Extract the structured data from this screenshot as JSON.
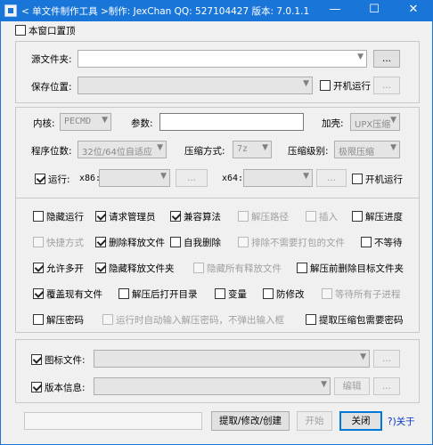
{
  "window": {
    "title": "< 单文件制作工具 >制作: JexChan  QQ: 527104427  版本: 7.0.1.1",
    "minimize": "—",
    "maximize": "☐",
    "close": "✕"
  },
  "top": {
    "on_top": "本窗口置顶"
  },
  "source": {
    "source_label": "源文件夹:",
    "browse": "...",
    "save_label": "保存位置:",
    "startup": "开机运行",
    "browse2": "..."
  },
  "kernel": {
    "core_label": "内核:",
    "core_value": "PECMD",
    "params_label": "参数:",
    "shell_label": "加壳:",
    "shell_value": "UPX压缩",
    "bits_label": "程序位数:",
    "bits_value": "32位/64位自适应",
    "method_label": "压缩方式:",
    "method_value": "7z",
    "level_label": "压缩级别:",
    "level_value": "极限压缩",
    "run_label": "运行:",
    "x86_label": "x86:",
    "x86_browse": "...",
    "x64_label": "x64:",
    "x64_browse": "...",
    "startup": "开机运行"
  },
  "options": {
    "row1": [
      "隐藏运行",
      "请求管理员",
      "兼容算法",
      "解压路径",
      "插入",
      "解压进度"
    ],
    "row2": [
      "快捷方式",
      "删除释放文件",
      "自我删除",
      "排除不需要打包的文件",
      "不等待"
    ],
    "row3": [
      "允许多开",
      "隐藏释放文件夹",
      "隐藏所有释放文件",
      "解压前删除目标文件夹"
    ],
    "row4": [
      "覆盖现有文件",
      "解压后打开目录",
      "变量",
      "防修改",
      "等待所有子进程"
    ],
    "row5": [
      "解压密码",
      "运行时自动输入解压密码，不弹出输入框",
      "提取压缩包需要密码"
    ]
  },
  "resources": {
    "icon_label": "图标文件:",
    "icon_browse": "...",
    "version_label": "版本信息:",
    "edit": "编辑",
    "version_browse": "..."
  },
  "footer": {
    "extract": "提取/修改/创建",
    "start": "开始",
    "close": "关闭",
    "about": "?)关于"
  }
}
